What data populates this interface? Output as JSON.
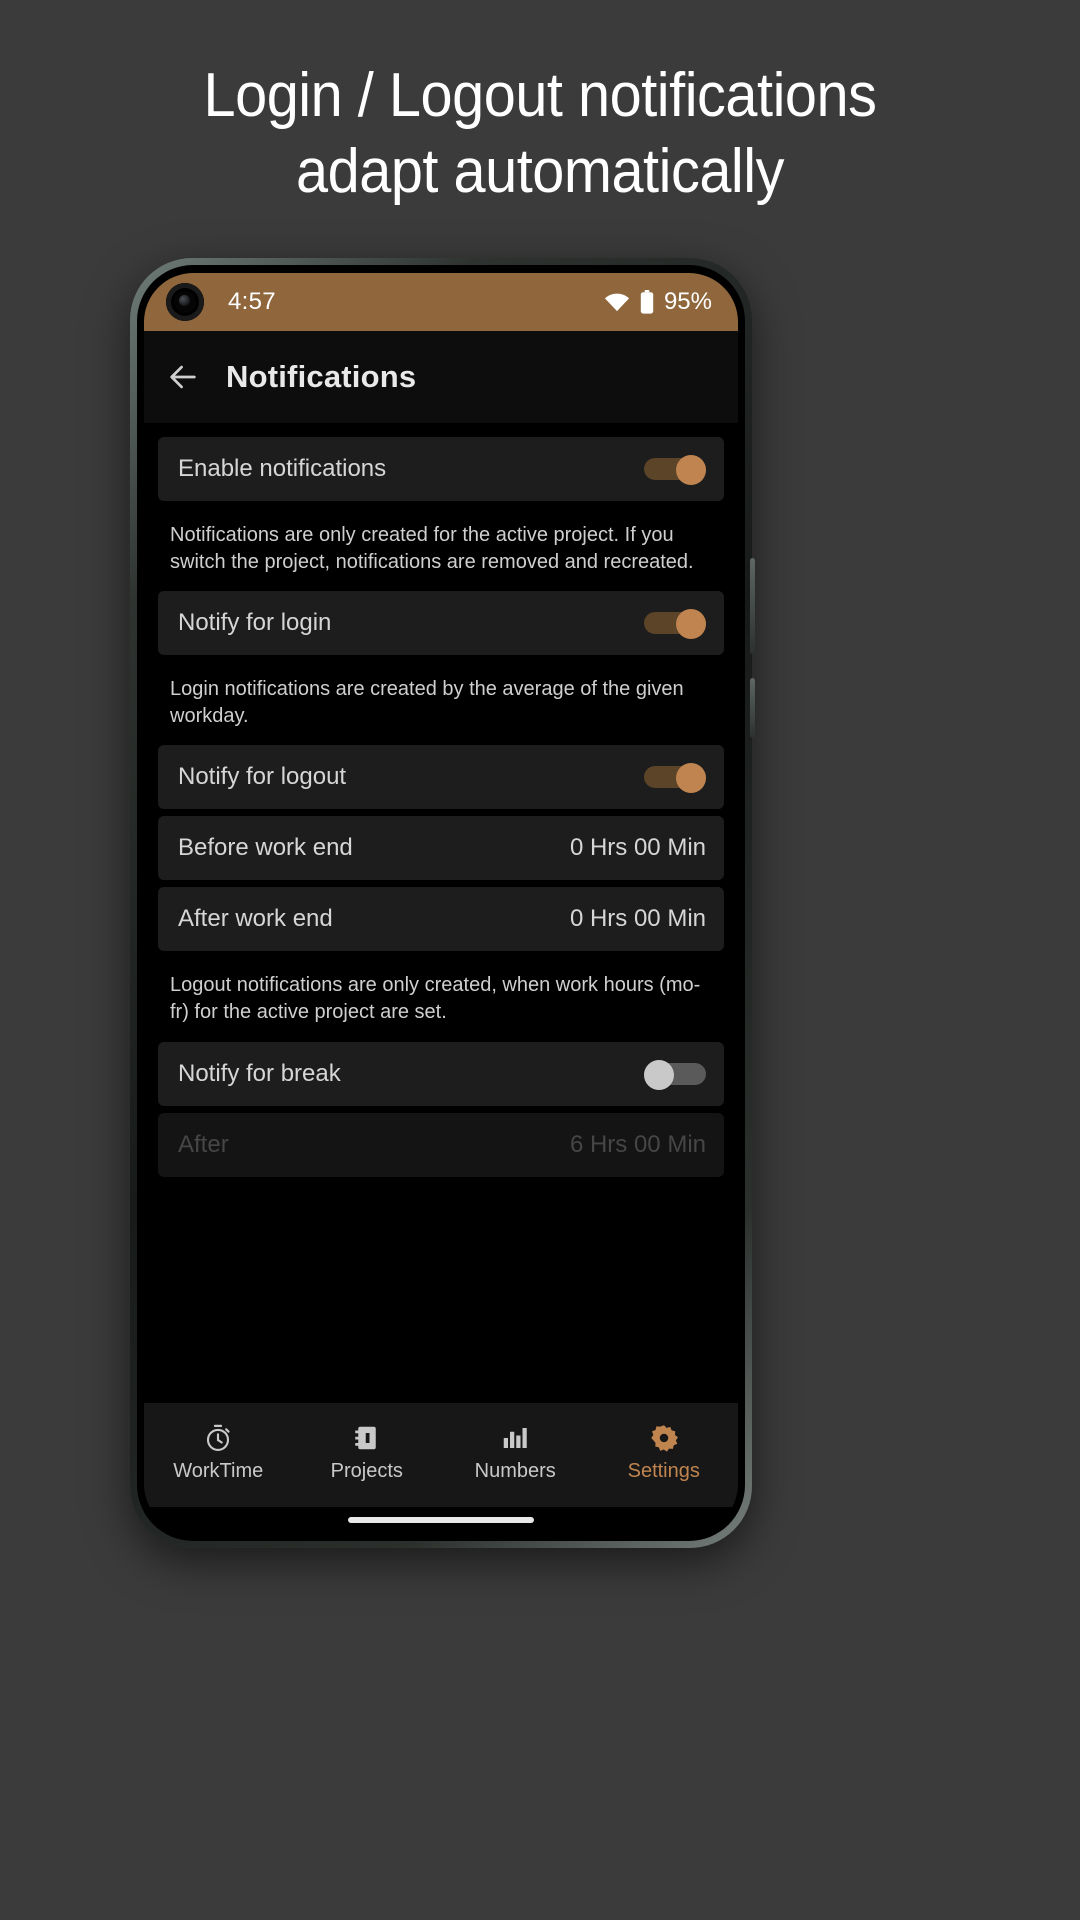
{
  "headline": {
    "line1": "Login / Logout notifications",
    "line2": "adapt automatically"
  },
  "colors": {
    "accent": "#c0844f",
    "status_bar_bg": "#90673c",
    "screen_bg": "#000000",
    "row_bg": "#1d1d1d",
    "page_bg": "#3b3b3b"
  },
  "status_bar": {
    "time": "4:57",
    "battery_percent": "95%",
    "wifi_icon": "wifi-icon",
    "battery_icon": "battery-icon",
    "camera_icon": "front-camera-punch-hole"
  },
  "app_bar": {
    "back_icon": "back-arrow-icon",
    "title": "Notifications"
  },
  "settings": {
    "enable_notifications": {
      "label": "Enable notifications",
      "toggle": "on"
    },
    "enable_notifications_hint": "Notifications are only created for the active project. If you switch the project, notifications are removed and recreated.",
    "notify_login": {
      "label": "Notify for login",
      "toggle": "on"
    },
    "notify_login_hint": "Login notifications are created by the average of the given workday.",
    "notify_logout": {
      "label": "Notify for logout",
      "toggle": "on"
    },
    "before_work_end": {
      "label": "Before work end",
      "value": "0 Hrs 00 Min"
    },
    "after_work_end": {
      "label": "After work end",
      "value": "0 Hrs 00 Min"
    },
    "notify_logout_hint": "Logout notifications are only created, when work hours (mo-fr) for the active project are set.",
    "notify_break": {
      "label": "Notify for break",
      "toggle": "off"
    },
    "break_after": {
      "label": "After",
      "value": "6 Hrs 00 Min"
    }
  },
  "bottom_nav": {
    "items": [
      {
        "label": "WorkTime",
        "icon": "stopwatch-icon",
        "active": false
      },
      {
        "label": "Projects",
        "icon": "projects-icon",
        "active": false
      },
      {
        "label": "Numbers",
        "icon": "bar-chart-icon",
        "active": false
      },
      {
        "label": "Settings",
        "icon": "gear-icon",
        "active": true
      }
    ]
  }
}
